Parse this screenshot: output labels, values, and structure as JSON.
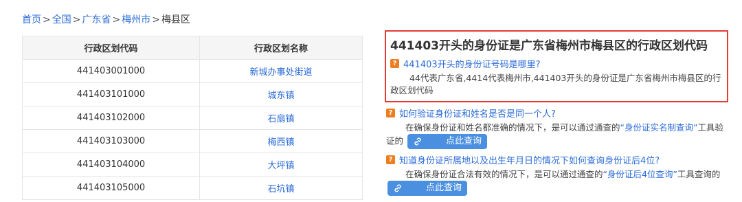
{
  "breadcrumb": [
    {
      "label": "首页"
    },
    {
      "label": "全国"
    },
    {
      "label": "广东省"
    },
    {
      "label": "梅州市"
    },
    {
      "label": "梅县区"
    }
  ],
  "table": {
    "headers": [
      "行政区划代码",
      "行政区划名称"
    ],
    "rows": [
      {
        "code": "441403001000",
        "name": "新城办事处街道"
      },
      {
        "code": "441403101000",
        "name": "城东镇"
      },
      {
        "code": "441403102000",
        "name": "石扇镇"
      },
      {
        "code": "441403103000",
        "name": "梅西镇"
      },
      {
        "code": "441403104000",
        "name": "大坪镇"
      },
      {
        "code": "441403105000",
        "name": "石坑镇"
      }
    ]
  },
  "highlight": {
    "title": "441403开头的身份证是广东省梅州市梅县区的行政区划代码",
    "question": "441403开头的身份证号码是哪里?",
    "answer": "44代表广东省,4414代表梅州市,441403开头的身份证是广东省梅州市梅县区的行政区划代码"
  },
  "qa2": {
    "question": "如何验证身份证和姓名是否是同一个人?",
    "answer_pre": "在确保身份证和姓名都准确的情况下，是可以通过通查的",
    "answer_link": "“身份证实名制查询”",
    "answer_post": "工具验证的",
    "button": "点此查询"
  },
  "qa3": {
    "question": "知道身份证所属地以及出生年月日的情况下如何查询身份证后4位?",
    "answer_pre": "在确保身份证合法有效的情况下，是可以通过通查的",
    "answer_link": "“身份证后4位查询”",
    "answer_post": "工具查询的",
    "button": "点此查询"
  },
  "colors": {
    "link": "#2b6cd8",
    "highlight_border": "#e53b34",
    "question_icon": "#ee7d20",
    "button": "#4a8fe0"
  },
  "icons": {
    "question": "question-mark-icon",
    "link": "link-icon"
  }
}
